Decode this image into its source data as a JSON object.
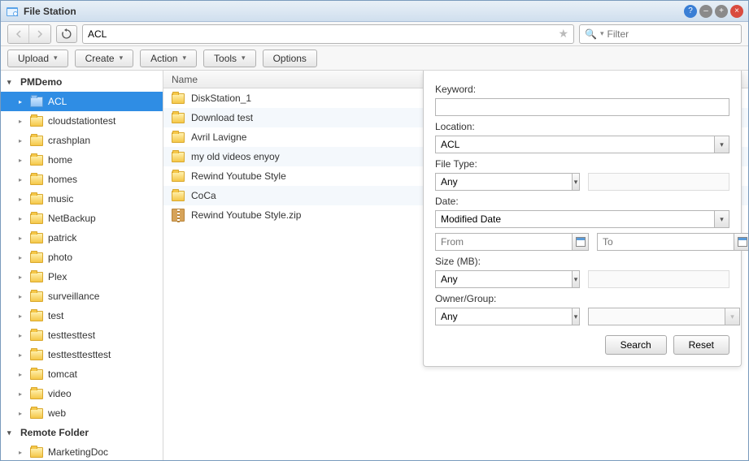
{
  "titlebar": {
    "title": "File Station"
  },
  "nav": {
    "path": "ACL",
    "filter_placeholder": "Filter"
  },
  "toolbar": {
    "upload": "Upload",
    "create": "Create",
    "action": "Action",
    "tools": "Tools",
    "options": "Options"
  },
  "sidebar": {
    "roots": [
      {
        "label": "PMDemo",
        "expanded": true,
        "items": [
          {
            "label": "ACL",
            "selected": true
          },
          {
            "label": "cloudstationtest"
          },
          {
            "label": "crashplan"
          },
          {
            "label": "home"
          },
          {
            "label": "homes"
          },
          {
            "label": "music"
          },
          {
            "label": "NetBackup"
          },
          {
            "label": "patrick"
          },
          {
            "label": "photo"
          },
          {
            "label": "Plex"
          },
          {
            "label": "surveillance"
          },
          {
            "label": "test"
          },
          {
            "label": "testtesttest"
          },
          {
            "label": "testtesttesttest"
          },
          {
            "label": "tomcat"
          },
          {
            "label": "video"
          },
          {
            "label": "web"
          }
        ]
      },
      {
        "label": "Remote Folder",
        "expanded": true,
        "items": [
          {
            "label": "MarketingDoc"
          }
        ]
      }
    ]
  },
  "filelist": {
    "header_name": "Name",
    "rows": [
      {
        "name": "DiskStation_1",
        "type": "folder"
      },
      {
        "name": "Download test",
        "type": "folder"
      },
      {
        "name": "Avril Lavigne",
        "type": "folder"
      },
      {
        "name": "my old videos enyoy",
        "type": "folder"
      },
      {
        "name": "Rewind Youtube Style",
        "type": "folder"
      },
      {
        "name": "CoCa",
        "type": "folder"
      },
      {
        "name": "Rewind Youtube Style.zip",
        "type": "zip"
      }
    ]
  },
  "search": {
    "keyword_label": "Keyword:",
    "location_label": "Location:",
    "location_value": "ACL",
    "filetype_label": "File Type:",
    "filetype_value": "Any",
    "date_label": "Date:",
    "date_value": "Modified Date",
    "from_placeholder": "From",
    "to_placeholder": "To",
    "size_label": "Size (MB):",
    "size_value": "Any",
    "owner_label": "Owner/Group:",
    "owner_value": "Any",
    "search_btn": "Search",
    "reset_btn": "Reset"
  }
}
